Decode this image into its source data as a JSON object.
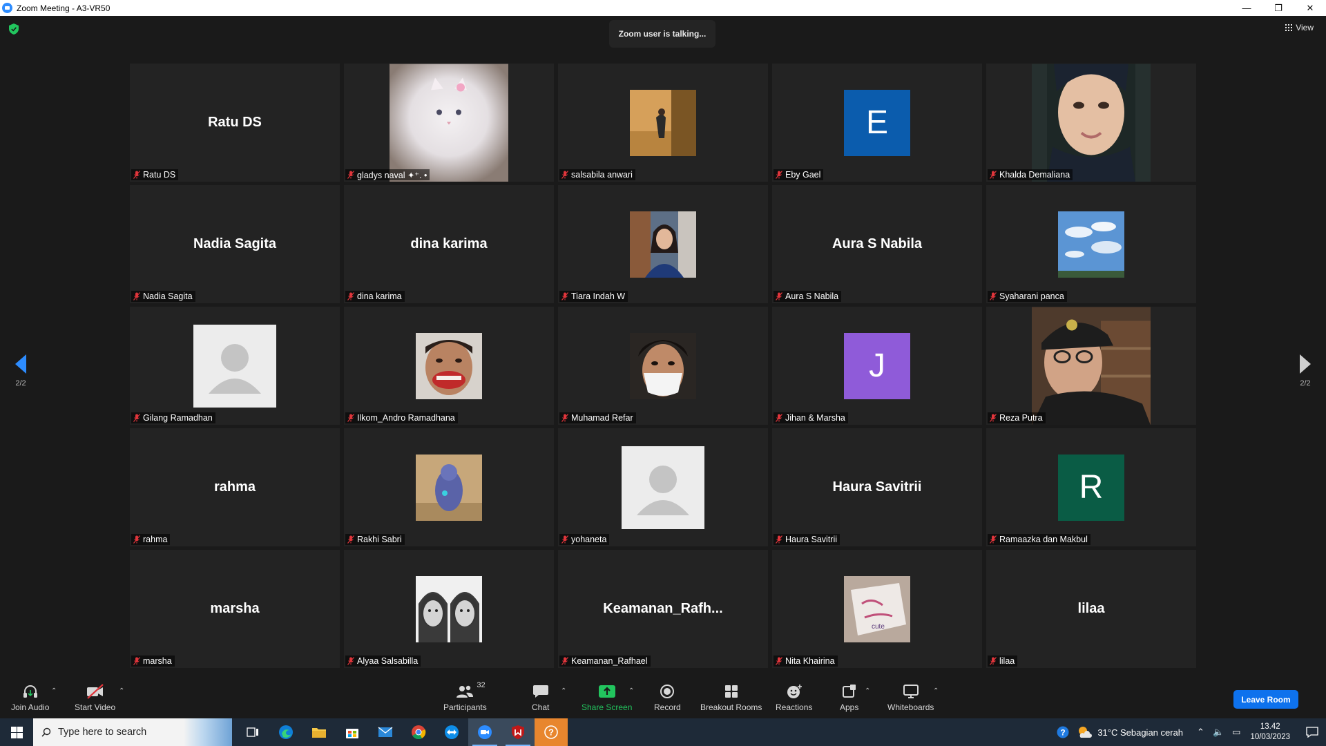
{
  "window": {
    "title": "Zoom Meeting - A3-VR50",
    "minimize": "—",
    "restore": "❐",
    "close": "✕"
  },
  "meeting": {
    "talking_text": "Zoom user is talking...",
    "view_label": "View",
    "page_left": "2/2",
    "page_right": "2/2"
  },
  "tiles": [
    {
      "label": "Ratu DS",
      "display": "Ratu DS",
      "kind": "name"
    },
    {
      "label": "gladys naval ✦⁺. •",
      "kind": "photo",
      "photo": "cat"
    },
    {
      "label": "salsabila anwari",
      "kind": "photo",
      "photo": "room"
    },
    {
      "label": "Eby Gael",
      "kind": "letter",
      "letter": "E",
      "color": "#0b5cad"
    },
    {
      "label": "Khalda Demaliana",
      "kind": "photo",
      "photo": "face-tall"
    },
    {
      "label": "Nadia Sagita",
      "display": "Nadia Sagita",
      "kind": "name"
    },
    {
      "label": "dina karima",
      "display": "dina karima",
      "kind": "name"
    },
    {
      "label": "Tiara Indah W",
      "kind": "photo",
      "photo": "selfie"
    },
    {
      "label": "Aura S Nabila",
      "display": "Aura S Nabila",
      "kind": "name"
    },
    {
      "label": "Syaharani panca",
      "kind": "photo",
      "photo": "sky"
    },
    {
      "label": "Gilang Ramadhan",
      "kind": "avatar"
    },
    {
      "label": "Ilkom_Andro Ramadhana",
      "kind": "photo",
      "photo": "face-smile"
    },
    {
      "label": "Muhamad Refar",
      "kind": "photo",
      "photo": "face-mask"
    },
    {
      "label": "Jihan & Marsha",
      "kind": "letter",
      "letter": "J",
      "color": "#8f5bd9"
    },
    {
      "label": "Reza Putra",
      "kind": "photo",
      "photo": "cap-tall"
    },
    {
      "label": "rahma",
      "display": "rahma",
      "kind": "name"
    },
    {
      "label": "Rakhi Sabri",
      "kind": "photo",
      "photo": "toy"
    },
    {
      "label": "yohaneta",
      "kind": "avatar"
    },
    {
      "label": "Haura Savitrii",
      "display": "Haura Savitrii",
      "kind": "name"
    },
    {
      "label": "Ramaazka dan Makbul",
      "kind": "letter",
      "letter": "R",
      "color": "#0a5c45"
    },
    {
      "label": "marsha",
      "display": "marsha",
      "kind": "name"
    },
    {
      "label": "Alyaa Salsabilla",
      "kind": "photo",
      "photo": "bw-faces"
    },
    {
      "label": "Keamanan_Rafhael",
      "display": "Keamanan_Rafh...",
      "kind": "name"
    },
    {
      "label": "Nita Khairina",
      "kind": "photo",
      "photo": "cast"
    },
    {
      "label": "lilaa",
      "display": "lilaa",
      "kind": "name"
    }
  ],
  "toolbar": {
    "join_audio": "Join Audio",
    "start_video": "Start Video",
    "participants": "Participants",
    "participants_count": "32",
    "chat": "Chat",
    "share_screen": "Share Screen",
    "record": "Record",
    "breakout_rooms": "Breakout Rooms",
    "reactions": "Reactions",
    "apps": "Apps",
    "whiteboards": "Whiteboards",
    "leave_room": "Leave Room"
  },
  "taskbar": {
    "search_placeholder": "Type here to search",
    "weather": "31°C  Sebagian cerah",
    "time": "13.42",
    "date": "10/03/2023"
  },
  "colors": {
    "share_green": "#22c55e",
    "leave_blue": "#0e72ed",
    "zoom_blue": "#2d8cff",
    "mic_red": "#e0353b"
  }
}
